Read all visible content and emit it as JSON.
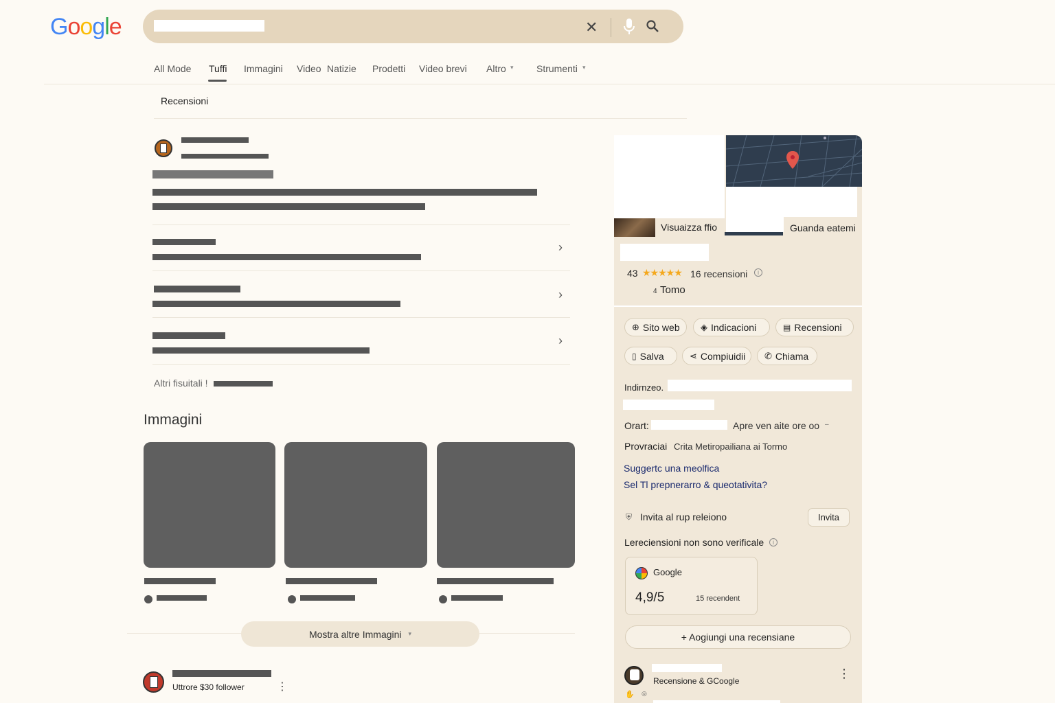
{
  "header": {
    "logo": "Google",
    "search_value": "",
    "icons": {
      "clear": "close-icon",
      "voice": "mic-icon",
      "search": "search-icon"
    }
  },
  "tabs": [
    {
      "label": "All Mode"
    },
    {
      "label": "Tuffi",
      "active": true
    },
    {
      "label": "Immagini"
    },
    {
      "label": "Video"
    },
    {
      "label": "Natizie"
    },
    {
      "label": "Prodetti"
    },
    {
      "label": "Video brevi"
    },
    {
      "label": "Altro"
    },
    {
      "label": "Strumenti"
    }
  ],
  "subtab": "Recensioni",
  "results": {
    "more_results_label": "Altri fisuitali !"
  },
  "images_section": {
    "title": "Immagini",
    "more_button": "Mostra altre Immagini"
  },
  "bottom_result": {
    "subtitle": "Uttrore $30 follower"
  },
  "panel": {
    "photo_label": "Visuaizza ffio",
    "map_label": "Guanda eatemi",
    "rating_value": "43",
    "stars": "★★★★★",
    "reviews_count": "16 recensioni",
    "category_prefix": "4",
    "category": "Tomo",
    "actions_row1": [
      "Sito web",
      "Indicacioni",
      "Recensioni"
    ],
    "actions_row2": [
      "Salva",
      "Compiuidii",
      "Chiama"
    ],
    "address_label": "Indirnzeo.",
    "hours_label": "Orart:",
    "hours_value": "Apre ven aite ore oo",
    "province_label": "Provraciai",
    "province_value": "Crita Metiropailiana ai Tormo",
    "suggest_link": "Suggertc una meolfica",
    "owner_link": "Sel Tl prepnerarro & queotativita?",
    "invite_text": "Invita al rup releiono",
    "invite_button": "Invita",
    "unverified": "Lereciensioni non sono verificale",
    "google_card": {
      "source": "Google",
      "score": "4,9/5",
      "count": "15 recendent"
    },
    "add_review": "+ Aogiungi una recensiane",
    "review_source": "Recensione & GCoogle",
    "accent_star": "#f4a81d",
    "map_color": "#2f3d4e",
    "pin_color": "#e2574c"
  }
}
